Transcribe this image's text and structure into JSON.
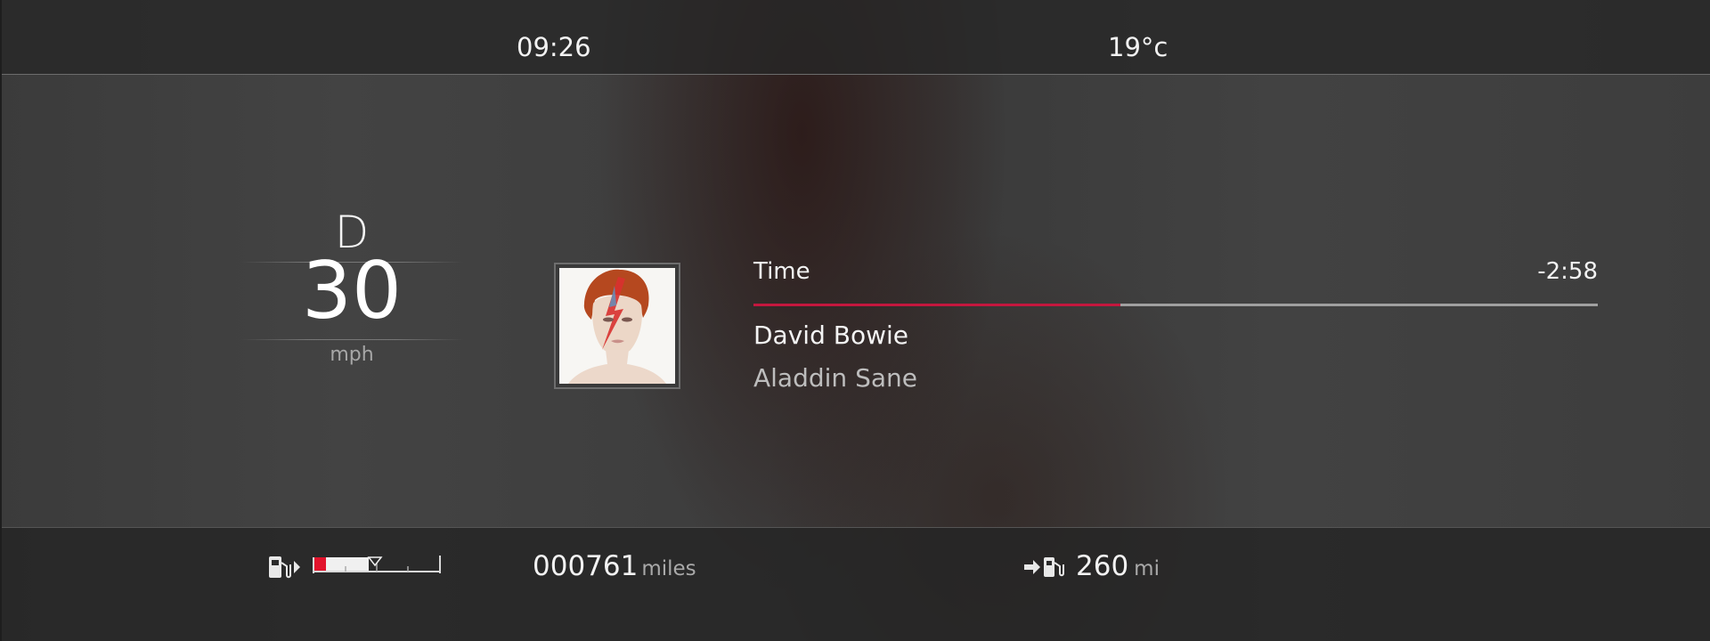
{
  "status_bar": {
    "time": "09:26",
    "temperature": "19°c"
  },
  "drive": {
    "gear": "D",
    "speed": "30",
    "speed_unit": "mph"
  },
  "media": {
    "time_label": "Time",
    "time_remaining": "-2:58",
    "progress_fraction": 0.435,
    "artist": "David Bowie",
    "album": "Aladdin Sane",
    "progress_color": "#c4173e"
  },
  "bottom_bar": {
    "fuel_icon": "fuel-pump-icon",
    "fuel_level_fraction": 0.1,
    "fuel_warning_color": "#e2132c",
    "odometer_value": "000761",
    "odometer_unit": "miles",
    "range_icon": "range-to-empty-icon",
    "range_value": "260",
    "range_unit": "mi"
  }
}
